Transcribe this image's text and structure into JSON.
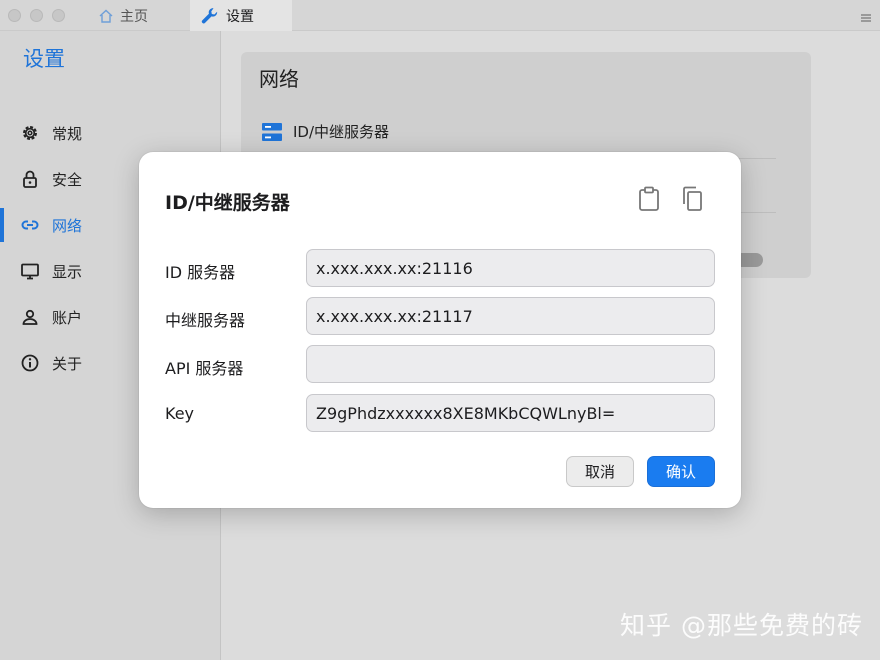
{
  "window": {
    "tabs": [
      {
        "label": "主页",
        "icon": "home-icon"
      },
      {
        "label": "设置",
        "icon": "wrench-icon"
      }
    ]
  },
  "sidebar": {
    "title": "设置",
    "items": [
      {
        "label": "常规",
        "icon": "gear-icon"
      },
      {
        "label": "安全",
        "icon": "lock-icon"
      },
      {
        "label": "网络",
        "icon": "link-icon",
        "active": true
      },
      {
        "label": "显示",
        "icon": "monitor-icon"
      },
      {
        "label": "账户",
        "icon": "user-icon"
      },
      {
        "label": "关于",
        "icon": "info-icon"
      }
    ]
  },
  "main": {
    "section_title": "网络",
    "server_row_label": "ID/中继服务器"
  },
  "dialog": {
    "title": "ID/中继服务器",
    "fields": [
      {
        "label": "ID 服务器",
        "value": "x.xxx.xxx.xx:21116"
      },
      {
        "label": "中继服务器",
        "value": "x.xxx.xxx.xx:21117"
      },
      {
        "label": "API 服务器",
        "value": ""
      },
      {
        "label": "Key",
        "value": "Z9gPhdzxxxxxx8XE8MKbCQWLnyBl="
      }
    ],
    "cancel_label": "取消",
    "confirm_label": "确认"
  },
  "watermark": "知乎 @那些免费的砖",
  "colors": {
    "accent": "#1f74d8",
    "confirm_button": "#1a7cf0"
  }
}
